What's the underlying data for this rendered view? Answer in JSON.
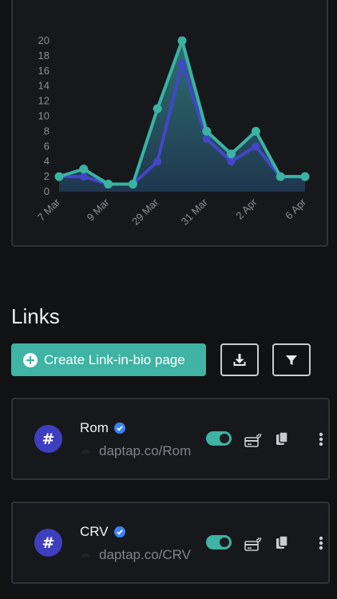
{
  "chart_data": {
    "type": "area",
    "x_ticks": [
      "7 Mar",
      "9 Mar",
      "29 Mar",
      "31 Mar",
      "2 Apr",
      "6 Apr"
    ],
    "yticks": [
      0,
      2,
      4,
      6,
      8,
      10,
      12,
      14,
      16,
      18,
      20
    ],
    "ylim": [
      0,
      20
    ],
    "series": [
      {
        "color": "#3ab3a3",
        "values": [
          2,
          3,
          1,
          1,
          11,
          20,
          8,
          5,
          8,
          2,
          2
        ]
      },
      {
        "color": "#4346c9",
        "values": [
          2,
          2,
          1,
          1,
          4,
          17,
          7,
          4,
          6,
          2,
          2
        ]
      }
    ],
    "grid": false
  },
  "links_section": {
    "title": "Links",
    "create_button_label": "Create Link-in-bio page",
    "download_icon": "download-icon",
    "filter_icon": "filter-icon"
  },
  "links": [
    {
      "avatar_symbol": "#",
      "name": "Rom",
      "verified": true,
      "url": "daptap.co/Rom",
      "enabled": true
    },
    {
      "avatar_symbol": "#",
      "name": "CRV",
      "verified": true,
      "url": "daptap.co/CRV",
      "enabled": true
    }
  ],
  "colors": {
    "accent": "#3fb3a4",
    "avatar": "#3e3fbf",
    "verified": "#3b82f6",
    "background": "#111214",
    "card": "#16181b"
  }
}
